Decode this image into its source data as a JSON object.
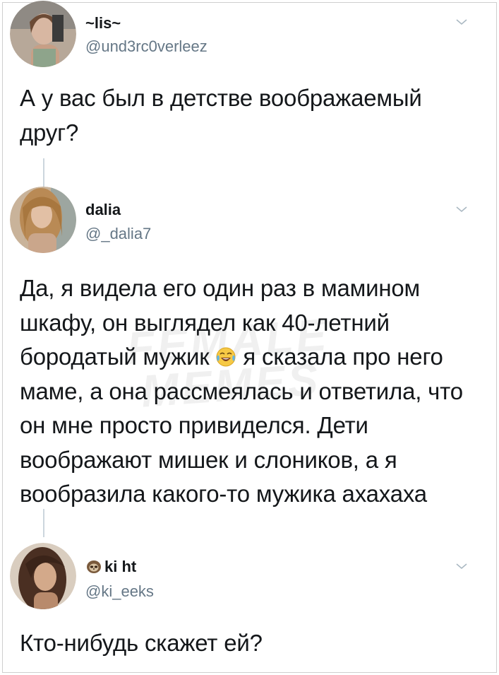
{
  "tweets": [
    {
      "name": "~lis~",
      "handle": "@und3rc0verleez",
      "text": "А у вас был в детстве воображаемый друг?"
    },
    {
      "name": "dalia",
      "handle": "@_dalia7",
      "text_before_emoji": "Да, я видела его один раз в мамином шкафу, он выглядел как 40-летний бородатый мужик ",
      "emoji": "face-with-tears-of-joy",
      "text_after_emoji": " я сказала про него маме, а она рассмеялась и ответила, что он мне просто привиделся. Дети воображают мишек и слоников, а я вообразила какого-то мужика ахахаха"
    },
    {
      "name_icon": "sloth-emoji",
      "name": "ki ht",
      "handle": "@ki_eeks",
      "text": "Кто-нибудь скажет ей?"
    }
  ],
  "watermark": "FEMALE MEMES",
  "colors": {
    "text": "#14171a",
    "secondary": "#657786",
    "thread_line": "#ccd6dd",
    "chevron": "#aab8c2"
  }
}
